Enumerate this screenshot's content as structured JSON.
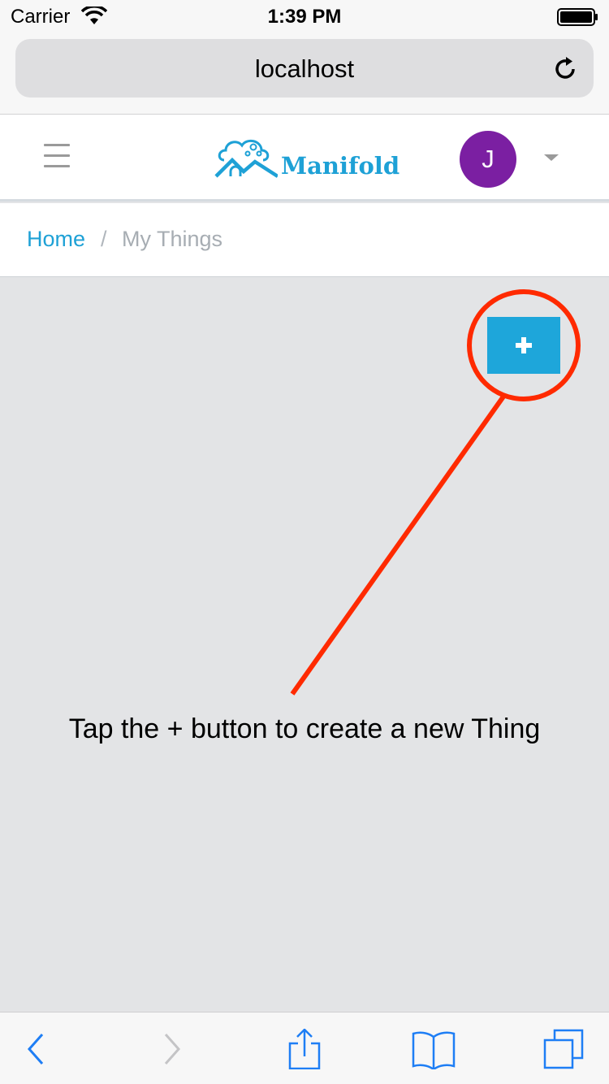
{
  "status_bar": {
    "carrier": "Carrier",
    "time": "1:39 PM"
  },
  "browser": {
    "url": "localhost"
  },
  "header": {
    "logo_text": "Manifold",
    "avatar_initial": "J"
  },
  "breadcrumb": {
    "home": "Home",
    "separator": "/",
    "current": "My Things"
  },
  "main": {
    "add_button_label": "+",
    "hint": "Tap the + button to create a new Thing"
  },
  "toolbar": {
    "icons": [
      "back-icon",
      "forward-icon",
      "share-icon",
      "bookmarks-icon",
      "tabs-icon"
    ]
  },
  "colors": {
    "accent": "#1ea6da",
    "avatar": "#7b1fa2",
    "annotation": "#ff2a00",
    "background": "#e3e4e6"
  }
}
